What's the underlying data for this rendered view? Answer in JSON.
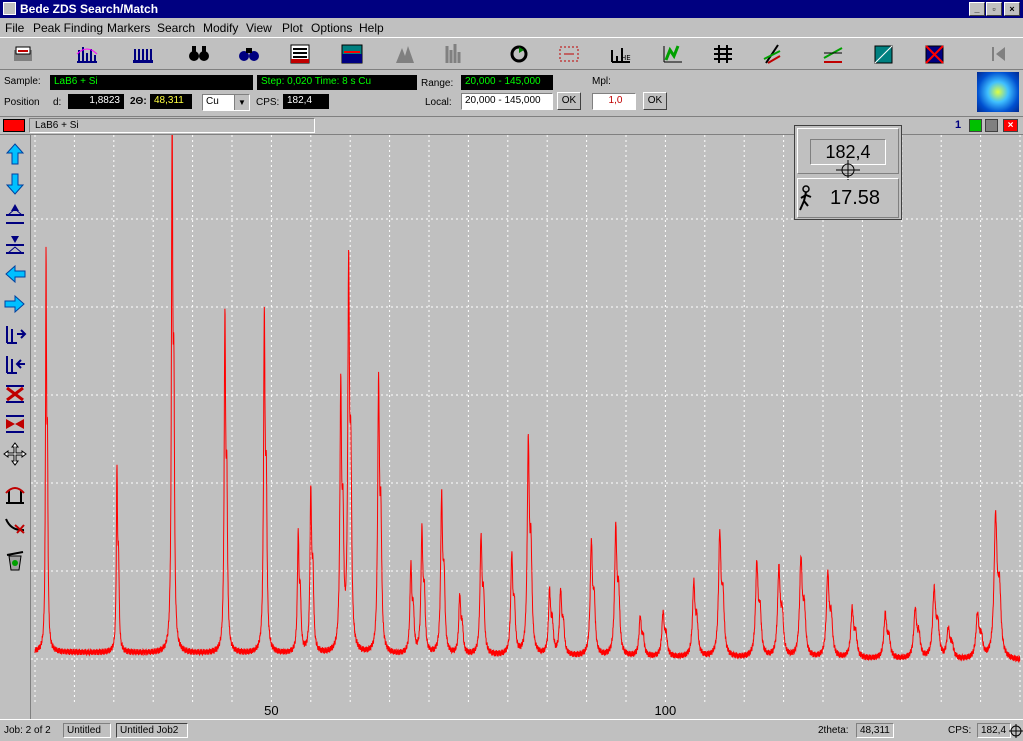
{
  "window": {
    "title": "Bede ZDS Search/Match"
  },
  "menu": [
    "File",
    "Peak Finding",
    "Markers",
    "Search",
    "Modify",
    "View",
    "Plot",
    "Options",
    "Help"
  ],
  "toolbar": {
    "icons": [
      "open-icon",
      "peak-search-icon",
      "peak-list-icon",
      "binoculars-icon",
      "search-match-icon",
      "pattern-list-icon",
      "overlay-icon",
      "triangle-peak-icon",
      "stick-pattern-icon",
      "rotate-icon",
      "zoom-box-icon",
      "marker-icon",
      "green-peak-icon",
      "grid-icon",
      "slope-icon",
      "background-icon",
      "square-icon",
      "cross-box-icon",
      "first-icon"
    ]
  },
  "info": {
    "sample_label": "Sample:",
    "sample_value": "LaB6 + Si",
    "step_value": "Step: 0,020   Time: 8 s   Cu",
    "range_label": "Range:",
    "range_value": "20,000 - 145,000",
    "mpl_label": "Mpl:",
    "position_label": "Position",
    "d_label": "d:",
    "d_value": "1,8823",
    "twotheta_label": "2Θ:",
    "twotheta_value": "48,311",
    "anode_value": "Cu",
    "cps_label": "CPS:",
    "cps_value": "182,4",
    "local_label": "Local:",
    "local_value": "20,000 - 145,000",
    "ok1": "OK",
    "mpl_value": "1,0",
    "ok2": "OK"
  },
  "docbar": {
    "title": "LaB6 + Si",
    "window_number": "1"
  },
  "readout": {
    "cps": "182,4",
    "value2": "17.58"
  },
  "plot": {
    "line_color": "#ff0000",
    "grid_color": "#ffffff",
    "background": "#c0c0c0",
    "x_ticks": [
      {
        "value": 50,
        "label": "50"
      },
      {
        "value": 100,
        "label": "100"
      }
    ]
  },
  "status": {
    "job": "Job: 2 of 2",
    "tab1": "Untitled",
    "tab2": "Untitled Job2",
    "twotheta_label": "2theta:",
    "twotheta_value": "48,311",
    "cps_label": "CPS:",
    "cps_value": "182,4"
  },
  "chart_data": {
    "type": "line",
    "title": "",
    "xlabel": "",
    "ylabel": "",
    "xlim": [
      20,
      145
    ],
    "x_ticks": [
      50,
      100
    ],
    "background_level": 8,
    "peaks": [
      {
        "x": 21.4,
        "y": 79
      },
      {
        "x": 30.4,
        "y": 37
      },
      {
        "x": 37.4,
        "y": 107
      },
      {
        "x": 44.1,
        "y": 68
      },
      {
        "x": 49.1,
        "y": 68
      },
      {
        "x": 53.4,
        "y": 24
      },
      {
        "x": 55.0,
        "y": 33
      },
      {
        "x": 58.8,
        "y": 53
      },
      {
        "x": 59.8,
        "y": 78
      },
      {
        "x": 63.6,
        "y": 55
      },
      {
        "x": 67.7,
        "y": 18
      },
      {
        "x": 69.1,
        "y": 25
      },
      {
        "x": 71.6,
        "y": 32
      },
      {
        "x": 73.9,
        "y": 12
      },
      {
        "x": 76.6,
        "y": 24
      },
      {
        "x": 80.5,
        "y": 20
      },
      {
        "x": 82.6,
        "y": 43
      },
      {
        "x": 85.3,
        "y": 13
      },
      {
        "x": 86.7,
        "y": 13
      },
      {
        "x": 90.6,
        "y": 23
      },
      {
        "x": 93.7,
        "y": 26
      },
      {
        "x": 96.8,
        "y": 8
      },
      {
        "x": 99.7,
        "y": 9
      },
      {
        "x": 103.6,
        "y": 15
      },
      {
        "x": 106.9,
        "y": 25
      },
      {
        "x": 111.6,
        "y": 19
      },
      {
        "x": 114.4,
        "y": 18
      },
      {
        "x": 117.2,
        "y": 20
      },
      {
        "x": 120.6,
        "y": 17
      },
      {
        "x": 123.7,
        "y": 10
      },
      {
        "x": 127.9,
        "y": 9
      },
      {
        "x": 131.7,
        "y": 10
      },
      {
        "x": 134.1,
        "y": 14
      },
      {
        "x": 135.9,
        "y": 6
      },
      {
        "x": 139.6,
        "y": 9
      },
      {
        "x": 141.9,
        "y": 29
      }
    ]
  }
}
